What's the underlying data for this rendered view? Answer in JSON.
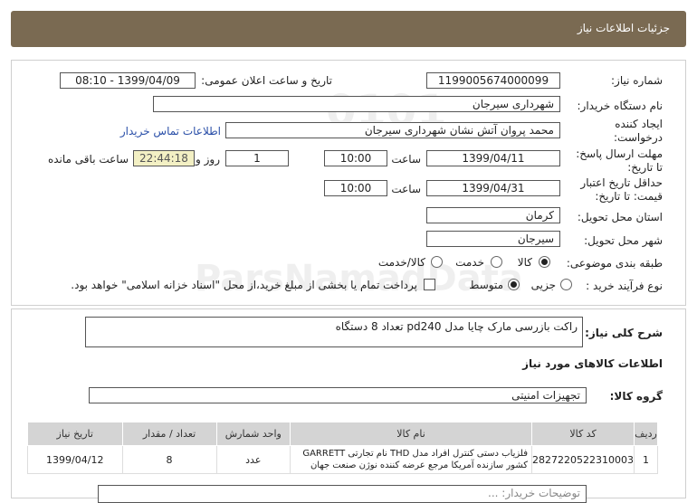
{
  "header": {
    "title": "جزئیات اطلاعات نیاز"
  },
  "form": {
    "need_number": {
      "label": "شماره نیاز:",
      "value": "1199005674000099"
    },
    "announce": {
      "label": "تاریخ و ساعت اعلان عمومی:",
      "value": "1399/04/09 - 08:10"
    },
    "buyer_org": {
      "label": "نام دستگاه خریدار:",
      "value": "شهرداری سیرجان"
    },
    "creator": {
      "label_line1": "ایجاد کننده",
      "label_line2": "درخواست:",
      "value": "محمد پروان آتش نشان شهرداری سیرجان",
      "contact_link": "اطلاعات تماس خریدار"
    },
    "deadline": {
      "label_line1": "مهلت ارسال پاسخ:",
      "label_line2": "تا تاریخ:",
      "date": "1399/04/11",
      "time_label": "ساعت",
      "time": "10:00",
      "days": "1",
      "days_label": "روز و",
      "remaining": "22:44:18",
      "remaining_label": "ساعت باقی مانده"
    },
    "validity": {
      "label_line1": "حداقل تاریخ اعتبار",
      "label_line2": "قیمت: تا تاریخ:",
      "date": "1399/04/31",
      "time_label": "ساعت",
      "time": "10:00"
    },
    "province": {
      "label": "استان محل تحویل:",
      "value": "کرمان"
    },
    "city": {
      "label": "شهر محل تحویل:",
      "value": "سیرجان"
    },
    "category": {
      "label": "طبقه بندی موضوعی:",
      "options": [
        "کالا",
        "خدمت",
        "کالا/خدمت"
      ],
      "selected": 0
    },
    "purchase": {
      "label": "نوع فرآیند خرید :",
      "options": [
        "جزیی",
        "متوسط"
      ],
      "selected": 1,
      "payment_note": "پرداخت تمام یا بخشی از مبلغ خرید،از محل \"اسناد خزانه اسلامی\" خواهد بود."
    }
  },
  "summary": {
    "label": "شرح کلی نیاز:",
    "value": "راکت بازرسی مارک چایا مدل pd240  تعداد 8 دستگاه"
  },
  "goods_section": {
    "title": "اطلاعات کالاهای مورد نیاز",
    "group_label": "گروه کالا:",
    "group_value": "تجهیزات امنیتی"
  },
  "table": {
    "headers": [
      "ردیف",
      "کد کالا",
      "نام کالا",
      "واحد شمارش",
      "تعداد / مقدار",
      "تاریخ نیاز"
    ],
    "rows": [
      [
        "1",
        "2827220522310003",
        "فلزیاب دستی کنترل افراد مدل THD نام تجارتی GARRETT کشور سازنده آمریکا مرجع عرضه کننده نوژن صنعت جهان",
        "عدد",
        "8",
        "1399/04/12"
      ]
    ]
  },
  "footer_partial": "توضیحات خریدار: ..."
}
